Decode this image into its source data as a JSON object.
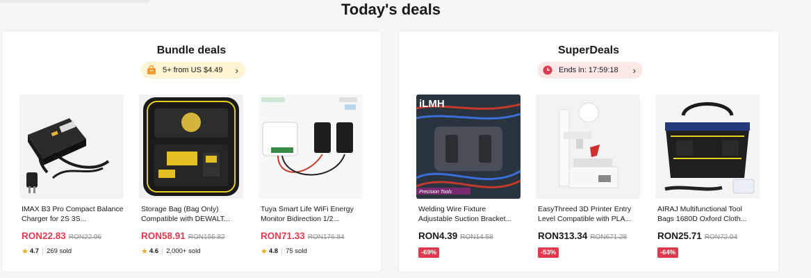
{
  "page": {
    "title": "Today's deals"
  },
  "bundle": {
    "title": "Bundle deals",
    "pill_text": "5+ from US $4.49",
    "items": [
      {
        "name": "IMAX B3 Pro Compact Balance Charger for 2S 3S...",
        "price": "RON22.83",
        "original_price": "RON22.96",
        "rating": "4.7",
        "sold": "269 sold"
      },
      {
        "name": "Storage Bag (Bag Only) Compatible with DEWALT...",
        "price": "RON58.91",
        "original_price": "RON156.82",
        "rating": "4.6",
        "sold": "2,000+ sold"
      },
      {
        "name": "Tuya Smart Life WiFi Energy Monitor Bidirection 1/2...",
        "price": "RON71.33",
        "original_price": "RON176.84",
        "rating": "4.8",
        "sold": "75 sold"
      }
    ]
  },
  "super": {
    "title": "SuperDeals",
    "pill_text": "Ends in: 17:59:18",
    "items": [
      {
        "name": "Welding Wire Fixture Adjustable Suction Bracket...",
        "price": "RON4.39",
        "original_price": "RON14.58",
        "discount": "-69%",
        "image_text": "iLMH",
        "image_caption": "Precision Tools"
      },
      {
        "name": "EasyThreed 3D Printer Entry Level Compatible with PLA...",
        "price": "RON313.34",
        "original_price": "RON671.28",
        "discount": "-53%"
      },
      {
        "name": "AIRAJ Multifunctional Tool Bags 1680D Oxford Cloth...",
        "price": "RON25.71",
        "original_price": "RON72.04",
        "discount": "-64%"
      }
    ]
  },
  "icons": {
    "bundle_pill": "shopping-bag-icon",
    "super_pill": "clock-icon",
    "chevron": "chevron-right-icon",
    "star": "star-icon"
  },
  "colors": {
    "price_red": "#e0394e",
    "discount_badge": "#e0394e",
    "bundle_pill_bg": "#fdf3d2",
    "super_pill_bg": "#fde8e8",
    "star": "#e8a91a"
  }
}
